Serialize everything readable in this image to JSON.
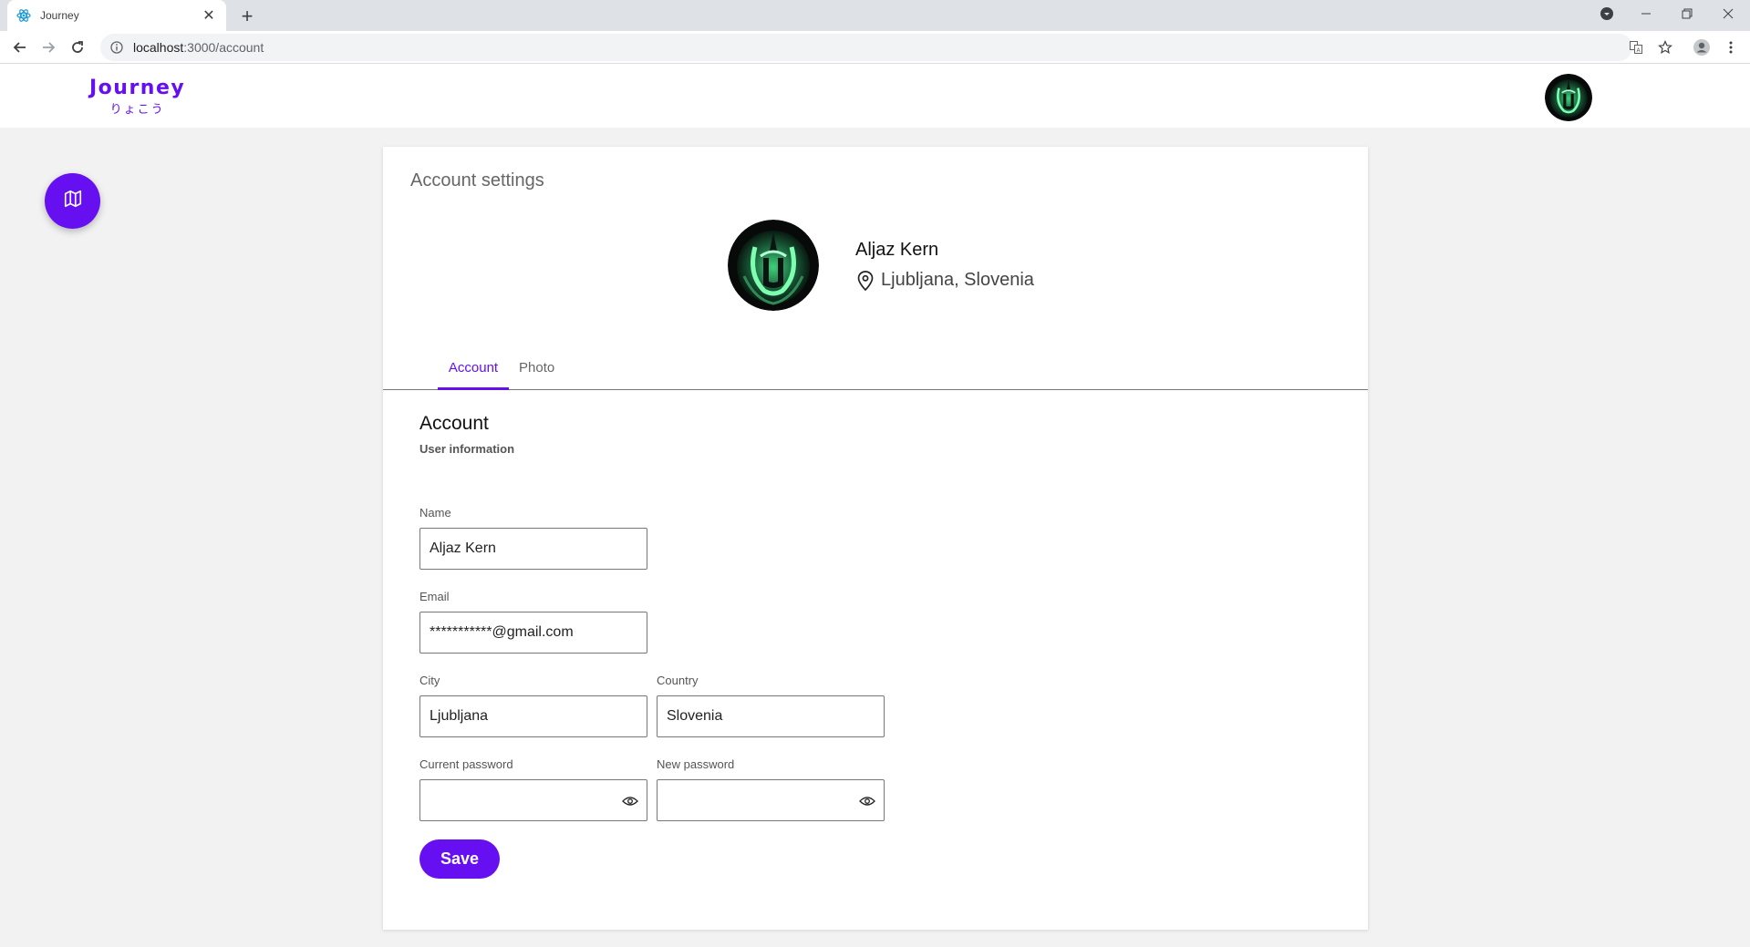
{
  "browser": {
    "tab_title": "Journey",
    "tab_close": "✕",
    "new_tab": "+",
    "url_host": "localhost",
    "url_rest": ":3000/account"
  },
  "header": {
    "brand_title": "Journey",
    "brand_subtitle": "りょこう"
  },
  "page": {
    "title": "Account settings"
  },
  "profile": {
    "name": "Aljaz Kern",
    "location": "Ljubljana, Slovenia"
  },
  "tabs": [
    {
      "label": "Account",
      "active": true
    },
    {
      "label": "Photo",
      "active": false
    }
  ],
  "section": {
    "title": "Account",
    "subtitle": "User information"
  },
  "form": {
    "name_label": "Name",
    "name_value": "Aljaz Kern",
    "email_label": "Email",
    "email_value": "***********@gmail.com",
    "city_label": "City",
    "city_value": "Ljubljana",
    "country_label": "Country",
    "country_value": "Slovenia",
    "current_password_label": "Current password",
    "current_password_value": "",
    "new_password_label": "New password",
    "new_password_value": "",
    "save_label": "Save"
  },
  "icons": {
    "favicon": "react-atom-icon",
    "map": "map-icon",
    "location": "location-pin-icon",
    "visibility": "eye-icon"
  },
  "colors": {
    "accent": "#6610f2",
    "background": "#f2f2f2",
    "card": "#ffffff"
  }
}
